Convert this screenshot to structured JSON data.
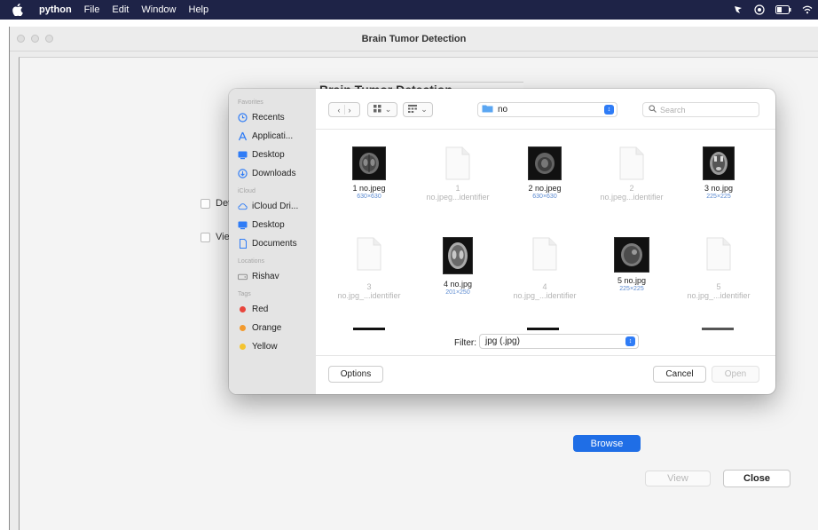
{
  "menubar": {
    "app_name": "python",
    "items": [
      "File",
      "Edit",
      "Window",
      "Help"
    ]
  },
  "window": {
    "title": "Brain Tumor Detection",
    "behind_title": "Brain Tumor Detection",
    "checkbox_detect": "Dete",
    "checkbox_view": "View",
    "browse_label": "Browse",
    "view_label": "View",
    "close_label": "Close"
  },
  "dialog": {
    "sidebar": {
      "favorites_heading": "Favorites",
      "favorites": [
        {
          "label": "Recents",
          "icon": "clock-icon"
        },
        {
          "label": "Applicati...",
          "icon": "applications-icon"
        },
        {
          "label": "Desktop",
          "icon": "desktop-icon"
        },
        {
          "label": "Downloads",
          "icon": "download-icon"
        }
      ],
      "icloud_heading": "iCloud",
      "icloud": [
        {
          "label": "iCloud Dri...",
          "icon": "cloud-icon"
        },
        {
          "label": "Desktop",
          "icon": "desktop-icon"
        },
        {
          "label": "Documents",
          "icon": "document-icon"
        }
      ],
      "locations_heading": "Locations",
      "locations": [
        {
          "label": "Rishav",
          "icon": "drive-icon"
        }
      ],
      "tags_heading": "Tags",
      "tags": [
        {
          "label": "Red",
          "color": "#e8453c"
        },
        {
          "label": "Orange",
          "color": "#f29a2e"
        },
        {
          "label": "Yellow",
          "color": "#f4c430"
        }
      ]
    },
    "toolbar": {
      "location": "no",
      "search_placeholder": "Search"
    },
    "files": [
      {
        "name": "1 no.jpeg",
        "meta": "630×630",
        "type": "image"
      },
      {
        "name": "1\nno.jpeg...identifier",
        "name1": "1",
        "name2": "no.jpeg...identifier",
        "type": "doc"
      },
      {
        "name": "2 no.jpeg",
        "meta": "630×630",
        "type": "image"
      },
      {
        "name1": "2",
        "name2": "no.jpeg...identifier",
        "type": "doc"
      },
      {
        "name": "3 no.jpg",
        "meta": "225×225",
        "type": "image"
      },
      {
        "name1": "3",
        "name2": "no.jpg_...identifier",
        "type": "doc"
      },
      {
        "name": "4 no.jpg",
        "meta": "201×250",
        "type": "image"
      },
      {
        "name1": "4",
        "name2": "no.jpg_...identifier",
        "type": "doc"
      },
      {
        "name": "5 no.jpg",
        "meta": "225×225",
        "type": "image"
      },
      {
        "name1": "5",
        "name2": "no.jpg_...identifier",
        "type": "doc"
      }
    ],
    "filter_label": "Filter:",
    "filter_value": "jpg (.jpg)",
    "options_label": "Options",
    "cancel_label": "Cancel",
    "open_label": "Open"
  },
  "colors": {
    "menubar_bg": "#1e2347",
    "accent_blue": "#1f6ee6"
  }
}
